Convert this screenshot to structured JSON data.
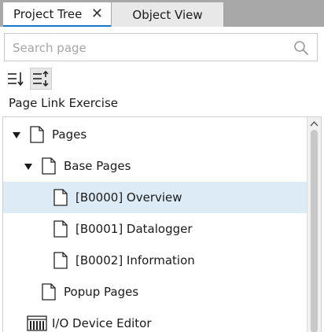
{
  "tabs": {
    "active_label": "Project Tree",
    "inactive_label": "Object View",
    "close_glyph": "✕"
  },
  "search": {
    "placeholder": "Search page",
    "value": ""
  },
  "toolbar": {
    "sort_icon": "sort-icon",
    "filter_icon": "filter-list-icon"
  },
  "project": {
    "title": "Page Link Exercise"
  },
  "tree": {
    "pages": "Pages",
    "base_pages": "Base Pages",
    "items": [
      "[B0000] Overview",
      "[B0001] Datalogger",
      "[B0002] Information"
    ],
    "popup_pages": "Popup Pages",
    "io_editor": "I/O Device Editor"
  },
  "colors": {
    "accent": "#1a73c8",
    "selected_row": "#ddebf7",
    "tab_bar": "#a8a8a8"
  }
}
